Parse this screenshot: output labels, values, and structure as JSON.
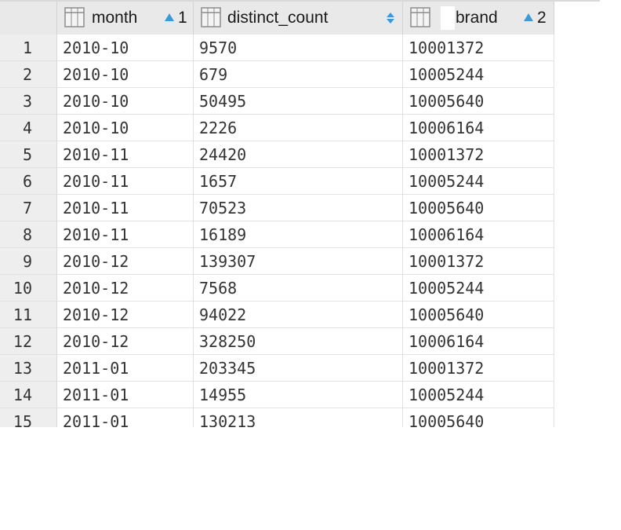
{
  "columns": [
    {
      "name": "month",
      "sort": "asc",
      "sort_order": "1"
    },
    {
      "name": "distinct_count",
      "sort": "none",
      "sort_order": ""
    },
    {
      "name": "brand",
      "sort": "asc",
      "sort_order": "2"
    }
  ],
  "rows": [
    {
      "n": "1",
      "month": "2010-10",
      "distinct_count": "9570",
      "brand": "10001372"
    },
    {
      "n": "2",
      "month": "2010-10",
      "distinct_count": "679",
      "brand": "10005244"
    },
    {
      "n": "3",
      "month": "2010-10",
      "distinct_count": "50495",
      "brand": "10005640"
    },
    {
      "n": "4",
      "month": "2010-10",
      "distinct_count": "2226",
      "brand": "10006164"
    },
    {
      "n": "5",
      "month": "2010-11",
      "distinct_count": "24420",
      "brand": "10001372"
    },
    {
      "n": "6",
      "month": "2010-11",
      "distinct_count": "1657",
      "brand": "10005244"
    },
    {
      "n": "7",
      "month": "2010-11",
      "distinct_count": "70523",
      "brand": "10005640"
    },
    {
      "n": "8",
      "month": "2010-11",
      "distinct_count": "16189",
      "brand": "10006164"
    },
    {
      "n": "9",
      "month": "2010-12",
      "distinct_count": "139307",
      "brand": "10001372"
    },
    {
      "n": "10",
      "month": "2010-12",
      "distinct_count": "7568",
      "brand": "10005244"
    },
    {
      "n": "11",
      "month": "2010-12",
      "distinct_count": "94022",
      "brand": "10005640"
    },
    {
      "n": "12",
      "month": "2010-12",
      "distinct_count": "328250",
      "brand": "10006164"
    },
    {
      "n": "13",
      "month": "2011-01",
      "distinct_count": "203345",
      "brand": "10001372"
    },
    {
      "n": "14",
      "month": "2011-01",
      "distinct_count": "14955",
      "brand": "10005244"
    },
    {
      "n": "15",
      "month": "2011-01",
      "distinct_count": "130213",
      "brand": "10005640"
    }
  ],
  "colors": {
    "header_bg": "#e9e9e9",
    "rownum_bg": "#eeeeee",
    "sort_arrow": "#3a9ad9"
  }
}
